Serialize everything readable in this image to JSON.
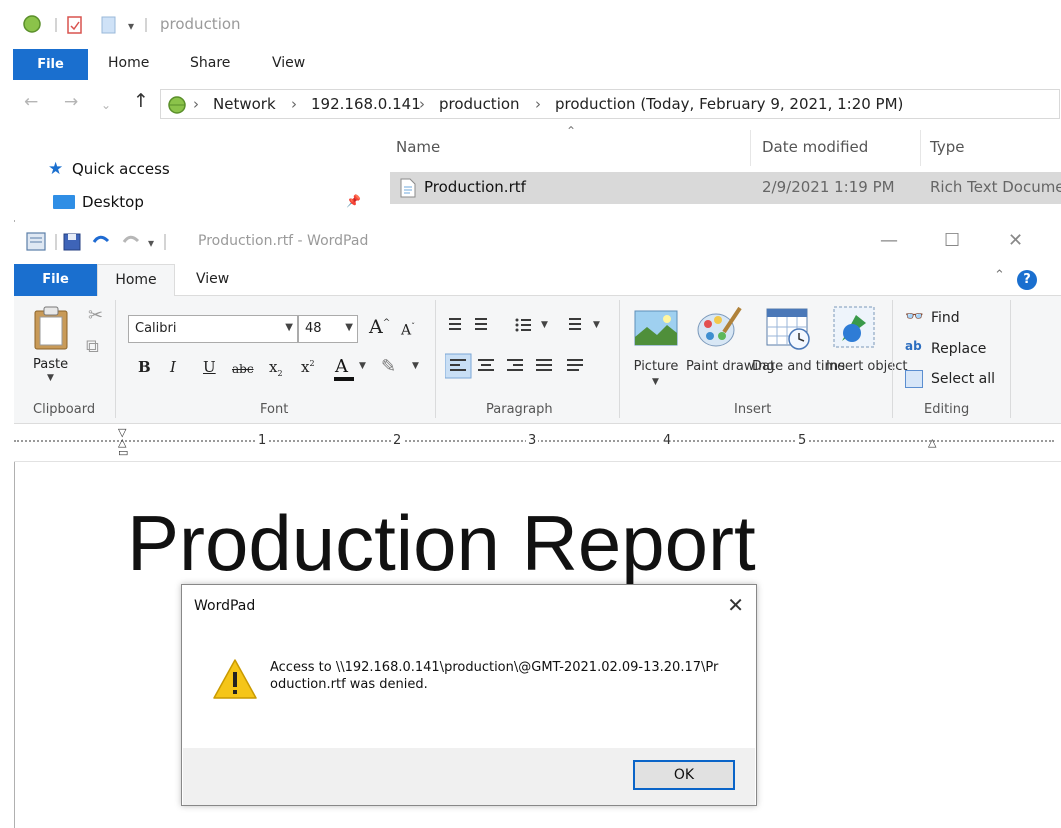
{
  "explorer": {
    "qat_title": "production",
    "tabs": {
      "file": "File",
      "home": "Home",
      "share": "Share",
      "view": "View"
    },
    "address": {
      "crumbs": [
        "Network",
        "192.168.0.141",
        "production",
        "production (Today, February 9, 2021, 1:20 PM)"
      ],
      "separator": "›"
    },
    "columns": {
      "name": "Name",
      "date": "Date modified",
      "type": "Type"
    },
    "row": {
      "name": "Production.rtf",
      "date": "2/9/2021 1:19 PM",
      "type": "Rich Text Docume"
    },
    "sidebar": {
      "quick_access": "Quick access",
      "desktop": "Desktop"
    }
  },
  "wordpad": {
    "title": "Production.rtf - WordPad",
    "tabs": {
      "file": "File",
      "home": "Home",
      "view": "View"
    },
    "clipboard": {
      "paste": "Paste",
      "group": "Clipboard"
    },
    "font": {
      "family": "Calibri",
      "size": "48",
      "group": "Font"
    },
    "paragraph": {
      "group": "Paragraph"
    },
    "insert": {
      "picture": "Picture",
      "paint": "Paint drawing",
      "datetime": "Date and time",
      "object": "Insert object",
      "group": "Insert"
    },
    "editing": {
      "find": "Find",
      "replace": "Replace",
      "select_all": "Select all",
      "group": "Editing"
    },
    "ruler_numbers": [
      "1",
      "2",
      "3",
      "4",
      "5"
    ],
    "document_text": "Production Report"
  },
  "dialog": {
    "title": "WordPad",
    "message": "Access to \\\\192.168.0.141\\production\\@GMT-2021.02.09-13.20.17\\Production.rtf was denied.",
    "ok": "OK"
  },
  "colors": {
    "accent": "#1a6fcf",
    "ok_border": "#0a64c8",
    "warning": "#f5c518"
  }
}
